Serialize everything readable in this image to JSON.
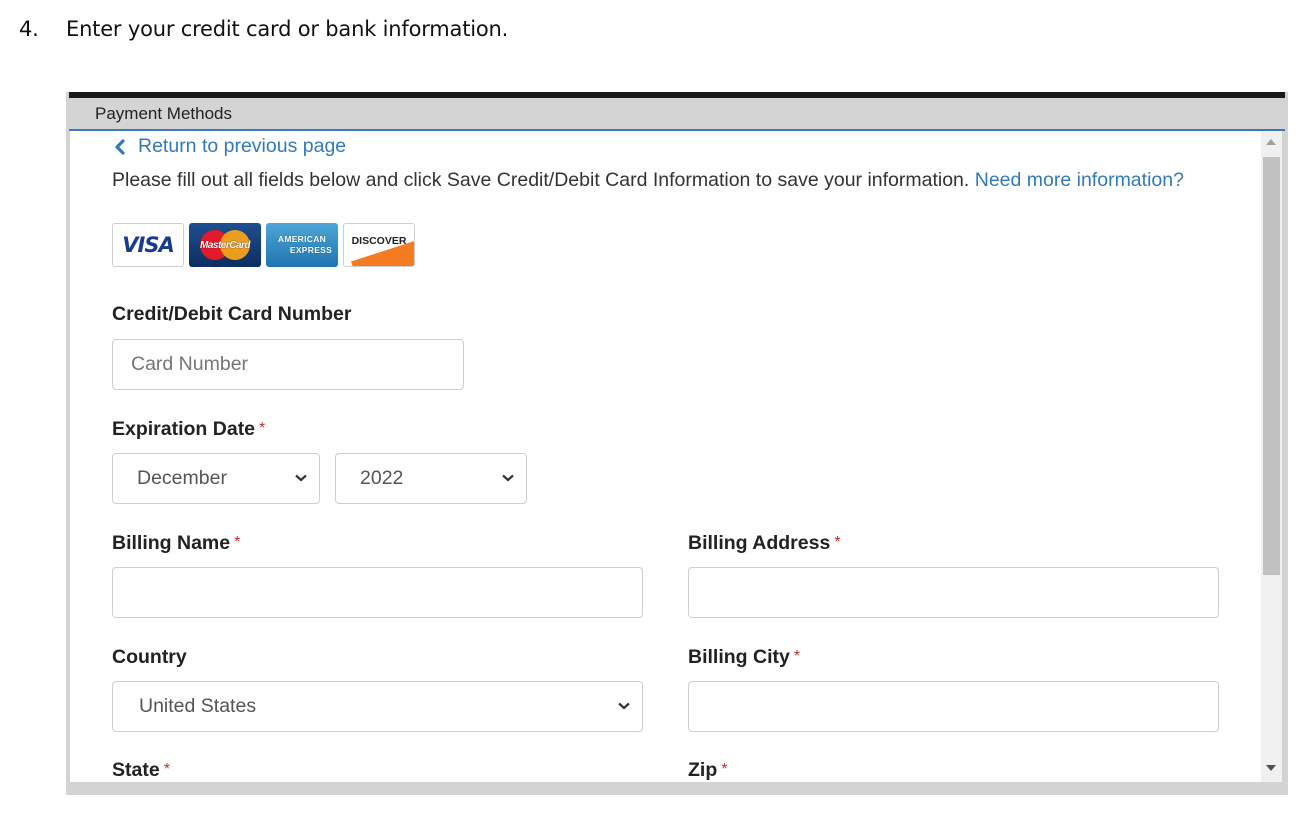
{
  "step": {
    "number": "4.",
    "text": "Enter your credit card or bank information."
  },
  "panel": {
    "title": "Payment Methods",
    "back_link": "Return to previous page",
    "intro_text": "Please fill out all fields below and click Save Credit/Debit Card Information to save your information.",
    "intro_link": "Need more information?",
    "card_logos": [
      {
        "name": "Visa",
        "label": "VISA"
      },
      {
        "name": "MasterCard",
        "label": "MasterCard"
      },
      {
        "name": "American Express",
        "label_line1": "AMERICAN",
        "label_line2": "EXPRESS"
      },
      {
        "name": "Discover",
        "label": "DISCOVER"
      }
    ],
    "form": {
      "card_number": {
        "label": "Credit/Debit Card Number",
        "placeholder": "Card Number",
        "value": ""
      },
      "expiration": {
        "label": "Expiration Date",
        "required_mark": "*",
        "month": "December",
        "year": "2022"
      },
      "billing_name": {
        "label": "Billing Name",
        "required_mark": "*",
        "value": ""
      },
      "billing_address": {
        "label": "Billing Address",
        "required_mark": "*",
        "value": ""
      },
      "country": {
        "label": "Country",
        "value": "United States"
      },
      "billing_city": {
        "label": "Billing City",
        "required_mark": "*",
        "value": ""
      },
      "state": {
        "label": "State",
        "required_mark": "*"
      },
      "zip": {
        "label": "Zip",
        "required_mark": "*"
      }
    }
  },
  "colors": {
    "link": "#337ab7",
    "required": "#c9302c",
    "header_rule": "#3a78bd"
  }
}
